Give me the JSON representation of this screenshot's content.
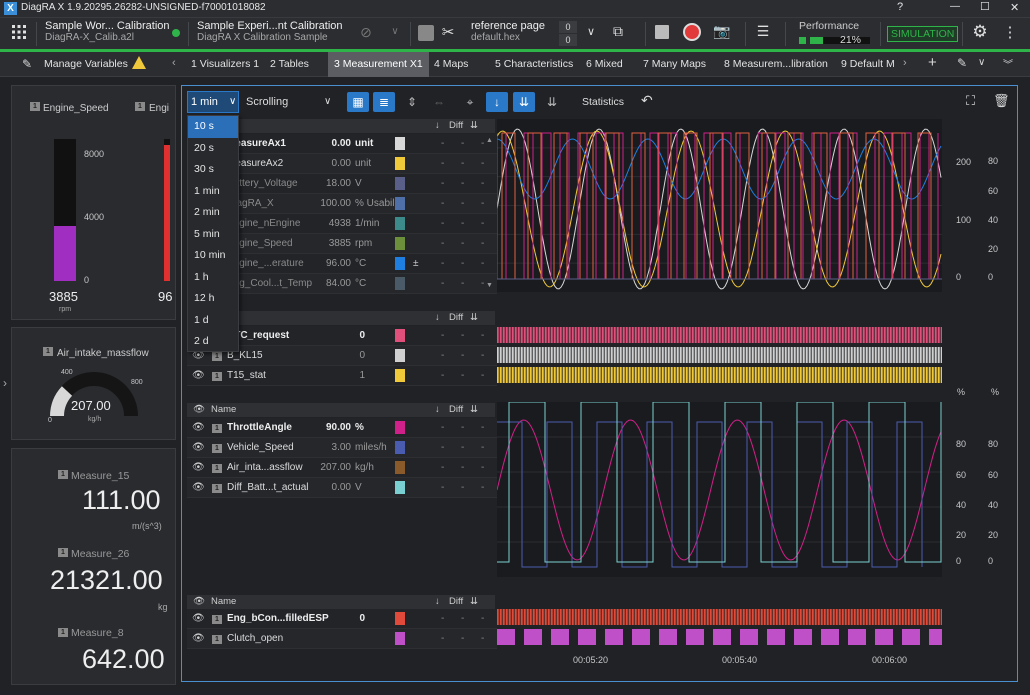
{
  "window": {
    "title": "DiagRA X 1.9.20295.26282-UNSIGNED-f70001018082",
    "help": "?",
    "min": "—",
    "max": "☐",
    "close": "✕"
  },
  "toolbar": {
    "project_title": "Sample Wor... Calibration",
    "project_file": "DiagRA-X_Calib.a2l",
    "experiment_title": "Sample Experi...nt Calibration",
    "experiment_sub": "DiagRA X Calibration Sample",
    "reference_title": "reference page",
    "reference_file": "default.hex",
    "ref_val1": "0",
    "ref_val2": "0",
    "performance_label": "Performance",
    "performance_value": "21%",
    "performance_fraction": 0.21,
    "simulation_label": "SIMULATION",
    "accent": "#2fb44a"
  },
  "tabs": {
    "manage_variables": "Manage Variables",
    "items": [
      "1 Visualizers 1",
      "2 Tables",
      "3 Measurement X1",
      "4 Maps",
      "5 Characteristics",
      "6 Mixed",
      "7 Many Maps",
      "8 Measurem...libration",
      "9 Default M"
    ],
    "active_index": 2
  },
  "left": {
    "gauge1_label": "Engine_Speed",
    "gauge1_value": "3885",
    "gauge1_unit": "rpm",
    "gauge1_ticks": [
      "8000",
      "4000",
      "0"
    ],
    "gauge1_fraction": 0.39,
    "gauge2_label": "Engi",
    "gauge2_value": "96",
    "gauge2_fraction": 0.96,
    "air_label": "Air_intake_massflow",
    "air_value": "207.00",
    "air_unit": "kg/h",
    "air_ticks": [
      "0",
      "400",
      "800"
    ],
    "m15_label": "Measure_15",
    "m15_value": "111.00",
    "m15_unit": "m/(s^3)",
    "m26_label": "Measure_26",
    "m26_value": "21321.00",
    "m26_unit": "kg",
    "m8_label": "Measure_8",
    "m8_value": "642.00",
    "index_badge": "1"
  },
  "viz": {
    "timespan": "1 min",
    "mode": "Scrolling",
    "statistics": "Statistics",
    "dropdown_options": [
      "10 s",
      "20 s",
      "30 s",
      "1 min",
      "2 min",
      "5 min",
      "10 min",
      "1 h",
      "12 h",
      "1 d",
      "2 d"
    ],
    "dropdown_selected": 0,
    "col_name": "Name",
    "col_diff": "Diff",
    "time_ticks": [
      "00:05:20",
      "00:05:40",
      "00:06:00"
    ]
  },
  "group1": {
    "rows": [
      {
        "name": "MeasureAx1",
        "value": "0.00",
        "unit": "unit",
        "color": "#d8d8d8",
        "bold": true
      },
      {
        "name": "MeasureAx2",
        "value": "0.00",
        "unit": "unit",
        "color": "#f0c93a",
        "bold": false
      },
      {
        "name": "Battery_Voltage",
        "value": "18.00",
        "unit": "V",
        "color": "#5a5f8a",
        "bold": false
      },
      {
        "name": "DiagRA_X",
        "value": "100.00",
        "unit": "% Usability",
        "color": "#4f6fa8",
        "bold": false
      },
      {
        "name": "Engine_nEngine",
        "value": "4938",
        "unit": "1/min",
        "color": "#3c8a8a",
        "bold": false
      },
      {
        "name": "Engine_Speed",
        "value": "3885",
        "unit": "rpm",
        "color": "#6b8f3a",
        "bold": false
      },
      {
        "name": "Engine_...erature",
        "value": "96.00",
        "unit": "°C",
        "color": "#1f7fe0",
        "bold": false
      },
      {
        "name": "Eng_Cool...t_Temp",
        "value": "84.00",
        "unit": "°C",
        "color": "#4a5a66",
        "bold": false
      }
    ],
    "y_left": [
      "200",
      "100",
      "0"
    ],
    "y_right": [
      "80",
      "60",
      "40",
      "20",
      "0"
    ],
    "dash": "-",
    "plusminus": "±"
  },
  "group2": {
    "rows": [
      {
        "name": "DTC_request",
        "value": "0",
        "color": "#e0507a",
        "bold": true
      },
      {
        "name": "B_KL15",
        "value": "0",
        "color": "#d0d0d0",
        "bold": false
      },
      {
        "name": "T15_stat",
        "value": "1",
        "color": "#f0c93a",
        "bold": false
      }
    ]
  },
  "group3": {
    "rows": [
      {
        "name": "ThrottleAngle",
        "value": "90.00",
        "unit": "%",
        "color": "#d0208a",
        "bold": true
      },
      {
        "name": "Vehicle_Speed",
        "value": "3.00",
        "unit": "miles/h",
        "color": "#4a5cb0",
        "bold": false
      },
      {
        "name": "Air_inta...assflow",
        "value": "207.00",
        "unit": "kg/h",
        "color": "#8a5a2a",
        "bold": false
      },
      {
        "name": "Diff_Batt...t_actual",
        "value": "0.00",
        "unit": "V",
        "color": "#7ad0d0",
        "bold": false
      }
    ],
    "y_left": [
      "80",
      "60",
      "40",
      "20",
      "0"
    ],
    "y_right": [
      "80",
      "60",
      "40",
      "20",
      "0"
    ],
    "unit_pct": "%"
  },
  "group4": {
    "rows": [
      {
        "name": "Eng_bCon...filledESP",
        "value": "0",
        "color": "#e04a3a",
        "bold": true
      },
      {
        "name": "Clutch_open",
        "value": "",
        "color": "#c050c8",
        "bold": false
      }
    ]
  }
}
